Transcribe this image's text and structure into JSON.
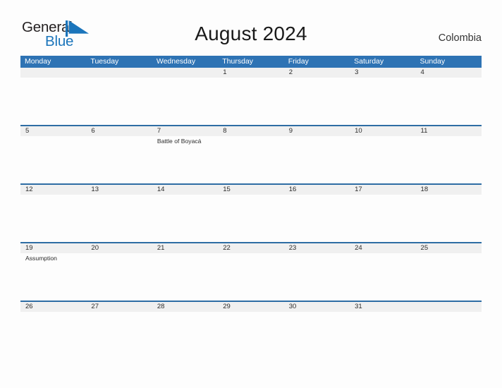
{
  "brand": {
    "name_part1": "General",
    "name_part2": "Blue",
    "flag_icon": "blue-triangle-flag-icon",
    "accent_color": "#1b75bb"
  },
  "header": {
    "title": "August 2024",
    "country": "Colombia"
  },
  "colors": {
    "header_blue": "#2e73b4",
    "rule_blue": "#2e6da4",
    "date_band_gray": "#f0f0f0",
    "page_background": "#fdfdfd",
    "text": "#2b2b2b"
  },
  "calendar": {
    "weekday_headers": [
      "Monday",
      "Tuesday",
      "Wednesday",
      "Thursday",
      "Friday",
      "Saturday",
      "Sunday"
    ],
    "weeks": [
      {
        "days": [
          {
            "date": "",
            "events": []
          },
          {
            "date": "",
            "events": []
          },
          {
            "date": "",
            "events": []
          },
          {
            "date": "1",
            "events": []
          },
          {
            "date": "2",
            "events": []
          },
          {
            "date": "3",
            "events": []
          },
          {
            "date": "4",
            "events": []
          }
        ]
      },
      {
        "days": [
          {
            "date": "5",
            "events": []
          },
          {
            "date": "6",
            "events": []
          },
          {
            "date": "7",
            "events": [
              "Battle of Boyacá"
            ]
          },
          {
            "date": "8",
            "events": []
          },
          {
            "date": "9",
            "events": []
          },
          {
            "date": "10",
            "events": []
          },
          {
            "date": "11",
            "events": []
          }
        ]
      },
      {
        "days": [
          {
            "date": "12",
            "events": []
          },
          {
            "date": "13",
            "events": []
          },
          {
            "date": "14",
            "events": []
          },
          {
            "date": "15",
            "events": []
          },
          {
            "date": "16",
            "events": []
          },
          {
            "date": "17",
            "events": []
          },
          {
            "date": "18",
            "events": []
          }
        ]
      },
      {
        "days": [
          {
            "date": "19",
            "events": [
              "Assumption"
            ]
          },
          {
            "date": "20",
            "events": []
          },
          {
            "date": "21",
            "events": []
          },
          {
            "date": "22",
            "events": []
          },
          {
            "date": "23",
            "events": []
          },
          {
            "date": "24",
            "events": []
          },
          {
            "date": "25",
            "events": []
          }
        ]
      },
      {
        "days": [
          {
            "date": "26",
            "events": []
          },
          {
            "date": "27",
            "events": []
          },
          {
            "date": "28",
            "events": []
          },
          {
            "date": "29",
            "events": []
          },
          {
            "date": "30",
            "events": []
          },
          {
            "date": "31",
            "events": []
          },
          {
            "date": "",
            "events": []
          }
        ]
      }
    ]
  }
}
